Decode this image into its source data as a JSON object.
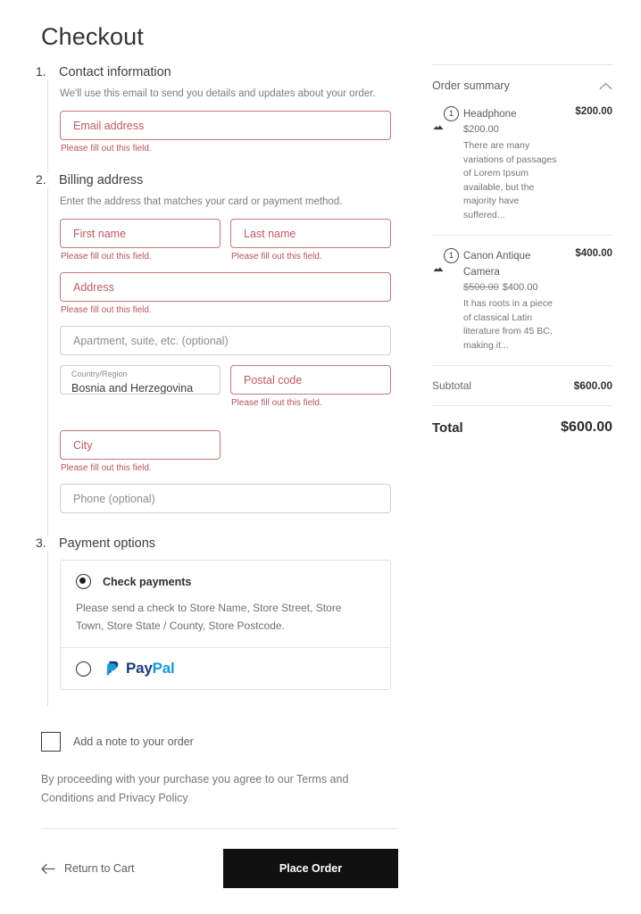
{
  "page": {
    "title": "Checkout"
  },
  "steps": [
    {
      "number": "1.",
      "title": "Contact information",
      "description": "We'll use this email to send you details and updates about your order."
    },
    {
      "number": "2.",
      "title": "Billing address",
      "description": "Enter the address that matches your card or payment method."
    },
    {
      "number": "3.",
      "title": "Payment options",
      "description": ""
    }
  ],
  "fields": {
    "email": {
      "placeholder": "Email address",
      "value": "",
      "error": "Please fill out this field."
    },
    "first_name": {
      "placeholder": "First name",
      "value": "",
      "error": "Please fill out this field."
    },
    "last_name": {
      "placeholder": "Last name",
      "value": "",
      "error": "Please fill out this field."
    },
    "address": {
      "placeholder": "Address",
      "value": "",
      "error": "Please fill out this field."
    },
    "apartment": {
      "placeholder": "Apartment, suite, etc. (optional)",
      "value": "",
      "error": ""
    },
    "country": {
      "label": "Country/Region",
      "value": "Bosnia and Herzegovina",
      "error": ""
    },
    "postal_code": {
      "placeholder": "Postal code",
      "value": "",
      "error": "Please fill out this field."
    },
    "city": {
      "placeholder": "City",
      "value": "",
      "error": "Please fill out this field."
    },
    "phone": {
      "placeholder": "Phone (optional)",
      "value": "",
      "error": ""
    }
  },
  "payment": {
    "options": [
      {
        "id": "check-payments",
        "label": "Check payments",
        "selected": true,
        "description": "Please send a check to Store Name, Store Street, Store Town, Store State / County, Store Postcode."
      },
      {
        "id": "paypal",
        "label": "PayPal",
        "selected": false,
        "logo_pay": "Pay",
        "logo_pal": "Pal"
      }
    ]
  },
  "note": {
    "label": "Add a note to your order",
    "checked": false
  },
  "terms": {
    "text": "By proceeding with your purchase you agree to our Terms and Conditions and Privacy Policy"
  },
  "actions": {
    "return_label": "Return to Cart",
    "place_order_label": "Place Order"
  },
  "summary": {
    "title": "Order summary",
    "collapsed": false,
    "items": [
      {
        "name": "Headphone",
        "quantity": "1",
        "line_total": "$200.00",
        "price": "$200.00",
        "old_price": "",
        "description": "There are many variations of passages of Lorem Ipsum available, but the majority have suffered..."
      },
      {
        "name": "Canon Antique Camera",
        "quantity": "1",
        "line_total": "$400.00",
        "price": "$400.00",
        "old_price": "$500.00",
        "description": "It has roots in a piece of classical Latin literature from 45 BC, making it..."
      }
    ],
    "totals": [
      {
        "label": "Subtotal",
        "value": "$600.00"
      }
    ],
    "grand_total": {
      "label": "Total",
      "value": "$600.00"
    }
  },
  "colors": {
    "error": "#b4555c",
    "error_border": "#c4777c",
    "button": "#111111",
    "paypal_dark": "#1b3a75",
    "paypal_light": "#199bd7"
  }
}
